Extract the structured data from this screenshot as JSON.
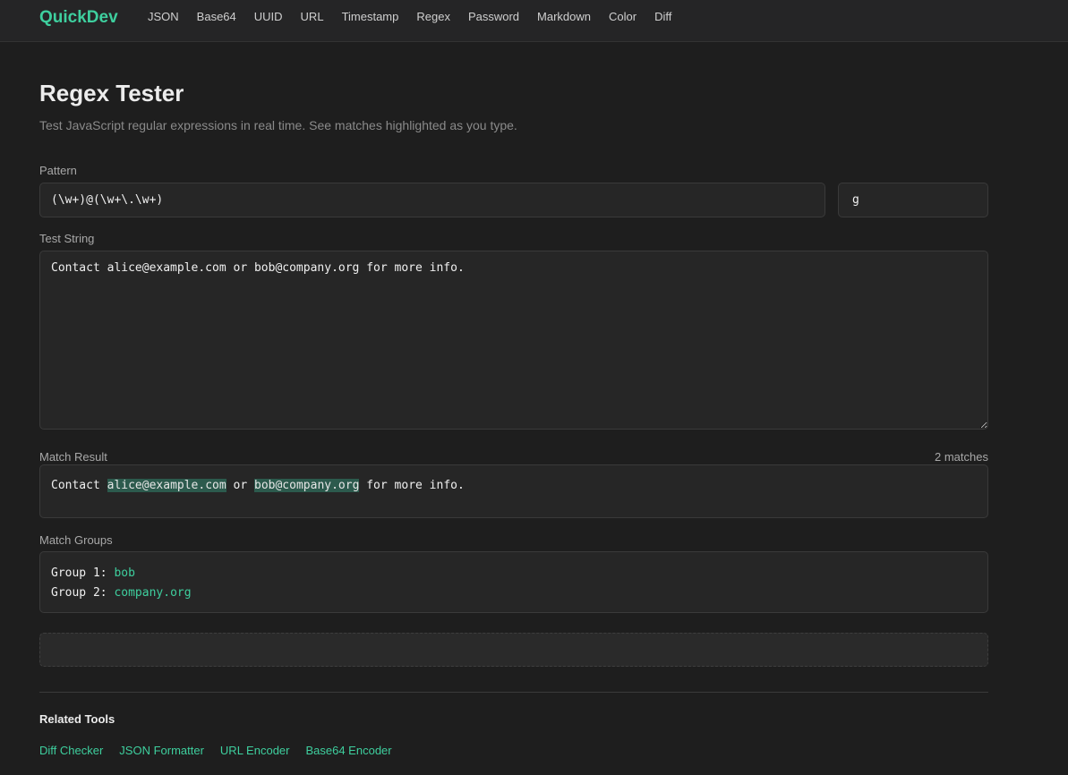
{
  "header": {
    "brand": "QuickDev",
    "nav": [
      "JSON",
      "Base64",
      "UUID",
      "URL",
      "Timestamp",
      "Regex",
      "Password",
      "Markdown",
      "Color",
      "Diff"
    ]
  },
  "page": {
    "title": "Regex Tester",
    "subtitle": "Test JavaScript regular expressions in real time. See matches highlighted as you type."
  },
  "pattern": {
    "label": "Pattern",
    "value": "(\\w+)@(\\w+\\.\\w+)",
    "flags": "g"
  },
  "test_string": {
    "label": "Test String",
    "value": "Contact alice@example.com or bob@company.org for more info."
  },
  "match_result": {
    "label": "Match Result",
    "count": "2 matches",
    "segments": [
      {
        "text": "Contact ",
        "match": false
      },
      {
        "text": "alice@example.com",
        "match": true
      },
      {
        "text": " or ",
        "match": false
      },
      {
        "text": "bob@company.org",
        "match": true
      },
      {
        "text": " for more info.",
        "match": false
      }
    ]
  },
  "match_groups": {
    "label": "Match Groups",
    "groups": [
      {
        "name": "Group 1: ",
        "value": "bob"
      },
      {
        "name": "Group 2: ",
        "value": "company.org"
      }
    ]
  },
  "related": {
    "title": "Related Tools",
    "links": [
      "Diff Checker",
      "JSON Formatter",
      "URL Encoder",
      "Base64 Encoder"
    ]
  },
  "colors": {
    "accent": "#3ecf9e",
    "background": "#1e1e1e",
    "match_highlight": "#2c5a4d"
  }
}
